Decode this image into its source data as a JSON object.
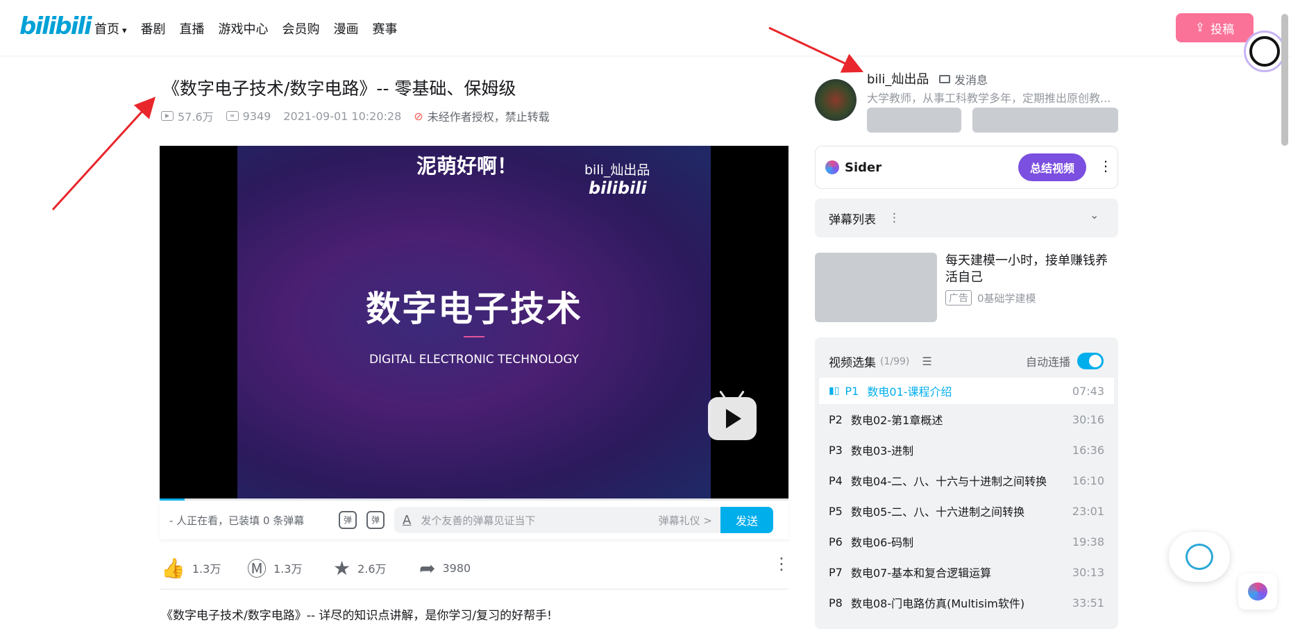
{
  "nav": {
    "logo": "bilibili",
    "items": [
      "首页",
      "番剧",
      "直播",
      "游戏中心",
      "会员购",
      "漫画",
      "赛事"
    ],
    "upload_label": "投稿"
  },
  "video": {
    "title": "《数字电子技术/数字电路》-- 零基础、保姆级",
    "views": "57.6万",
    "danmaku_count": "9349",
    "date": "2021-09-01 10:20:28",
    "copyright": "未经作者授权，禁止转载",
    "slide": {
      "greeting": "泥萌好啊！",
      "brand": "bili_灿出品",
      "brand_logo": "bilibili",
      "main_text": "数字电子技术",
      "sub_text": "DIGITAL ELECTRONIC TECHNOLOGY"
    },
    "progress": 0.04
  },
  "danmaku_bar": {
    "viewers": "- 人正在看，已装填 0 条弹幕",
    "icon1": "弹",
    "icon2": "弹",
    "placeholder": "发个友善的弹幕见证当下",
    "etiquette": "弹幕礼仪 >",
    "send": "发送"
  },
  "actions": {
    "like": "1.3万",
    "coin": "1.3万",
    "fav": "2.6万",
    "share": "3980"
  },
  "description": "《数字电子技术/数字电路》-- 详尽的知识点讲解，是你学习/复习的好帮手!",
  "uploader": {
    "name": "bili_灿出品",
    "message": "发消息",
    "bio": "大学教师，从事工科教学多年，定期推出原创教..."
  },
  "sider": {
    "name": "Sider",
    "summarize": "总结视频"
  },
  "danmaku_list": {
    "label": "弹幕列表"
  },
  "ad": {
    "title": "每天建模一小时，接单赚钱养活自己",
    "tag": "广告",
    "source": "0基础学建模"
  },
  "playlist": {
    "title": "视频选集",
    "count": "(1/99)",
    "autoplay": "自动连播",
    "items": [
      {
        "p": "P1",
        "title": "数电01-课程介绍",
        "dur": "07:43"
      },
      {
        "p": "P2",
        "title": "数电02-第1章概述",
        "dur": "30:16"
      },
      {
        "p": "P3",
        "title": "数电03-进制",
        "dur": "16:36"
      },
      {
        "p": "P4",
        "title": "数电04-二、八、十六与十进制之间转换",
        "dur": "16:10"
      },
      {
        "p": "P5",
        "title": "数电05-二、八、十六进制之间转换",
        "dur": "23:01"
      },
      {
        "p": "P6",
        "title": "数电06-码制",
        "dur": "19:38"
      },
      {
        "p": "P7",
        "title": "数电07-基本和复合逻辑运算",
        "dur": "30:13"
      },
      {
        "p": "P8",
        "title": "数电08-门电路仿真(Multisim软件)",
        "dur": "33:51"
      }
    ]
  },
  "colors": {
    "accent": "#00aeec",
    "pink": "#fb7299",
    "annotation_arrow": "#e8262b"
  }
}
